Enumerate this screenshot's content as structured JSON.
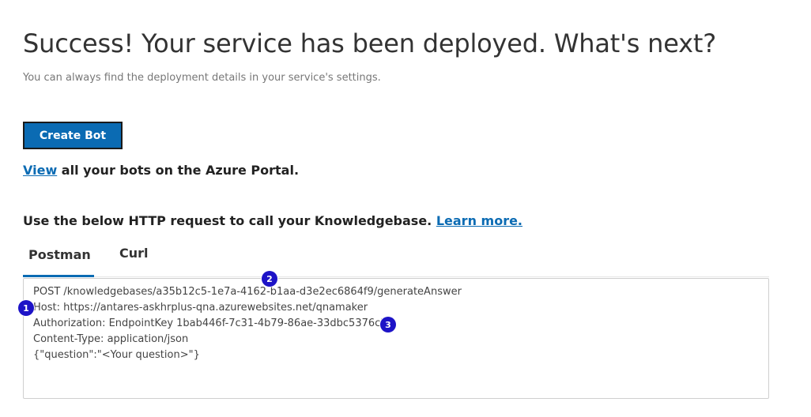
{
  "header": {
    "title": "Success! Your service has been deployed. What's next?",
    "subtitle": "You can always find the deployment details in your service's settings."
  },
  "actions": {
    "create_bot_label": "Create Bot",
    "view_link": "View",
    "view_rest": " all your bots on the Azure Portal."
  },
  "http_section": {
    "intro": "Use the below HTTP request to call your Knowledgebase. ",
    "learn_more": "Learn more."
  },
  "tabs": [
    {
      "label": "Postman",
      "active": true
    },
    {
      "label": "Curl",
      "active": false
    }
  ],
  "code_lines": [
    "POST /knowledgebases/a35b12c5-1e7a-4162-b1aa-d3e2ec6864f9/generateAnswer",
    "Host: https://antares-askhrplus-qna.azurewebsites.net/qnamaker",
    "Authorization: EndpointKey 1bab446f-7c31-4b79-86ae-33dbc5376c2d",
    "Content-Type: application/json",
    "{\"question\":\"<Your question>\"}"
  ],
  "annotations": [
    "1",
    "2",
    "3"
  ],
  "colors": {
    "accent": "#0b6bb3",
    "badge": "#1d13c7"
  }
}
